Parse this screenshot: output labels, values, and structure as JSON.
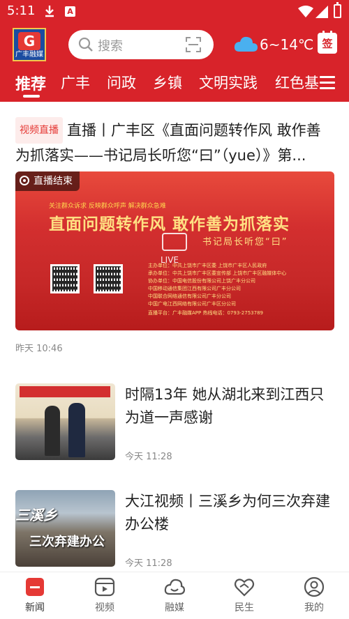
{
  "status": {
    "time": "5:11"
  },
  "header": {
    "logo_text": "广丰融媒",
    "search_placeholder": "搜索",
    "weather": "6~14℃",
    "signin": "签"
  },
  "tabs": [
    "推荐",
    "广丰",
    "问政",
    "乡镇",
    "文明实践",
    "红色基"
  ],
  "feed": {
    "top_story": {
      "badge": "视频直播",
      "title": "直播丨广丰区《直面问题转作风 敢作善为抓落实——书记局长听您“曰”（yue）》第...",
      "live_label": "直播结束",
      "hero_tagline": "关注群众诉求  反映群众呼声  解决群众急难",
      "hero_title": "直面问题转作风  敢作善为抓落实",
      "hero_sub": "书记局长听您“曰”",
      "hero_live": "LIVE",
      "hero_lines": [
        "主办单位：中共上饶市广丰区委  上饶市广丰区人民政府",
        "承办单位：中共上饶市广丰区委宣传部  上饶市广丰区融媒体中心",
        "协办单位：中国电信股份有限公司上饶广丰分公司",
        "中国移动通信集团江西有限公司广丰分公司",
        "中国联合网络通信有限公司广丰分公司",
        "中国广电江西网络有限公司广丰区分公司"
      ],
      "hero_footer": "直播平台：广丰融媒APP    热线电话：0793-2753789",
      "time": "昨天 10:46"
    },
    "items": [
      {
        "title": "时隔13年 她从湖北来到江西只为道一声感谢",
        "time": "今天 11:28",
        "thumb_text": ""
      },
      {
        "title": "大江视频丨三溪乡为何三次弃建办公楼",
        "time": "今天 11:28",
        "thumb_text": "三溪乡",
        "thumb_text2": "三次弃建办公"
      }
    ]
  },
  "bottom_nav": [
    {
      "label": "新闻",
      "icon": "news-icon",
      "active": true
    },
    {
      "label": "视频",
      "icon": "video-icon",
      "active": false
    },
    {
      "label": "融媒",
      "icon": "media-cloud-icon",
      "active": false
    },
    {
      "label": "民生",
      "icon": "heart-hands-icon",
      "active": false
    },
    {
      "label": "我的",
      "icon": "profile-icon",
      "active": false
    }
  ],
  "colors": {
    "brand_red": "#d8232a",
    "badge_red": "#e53935"
  }
}
